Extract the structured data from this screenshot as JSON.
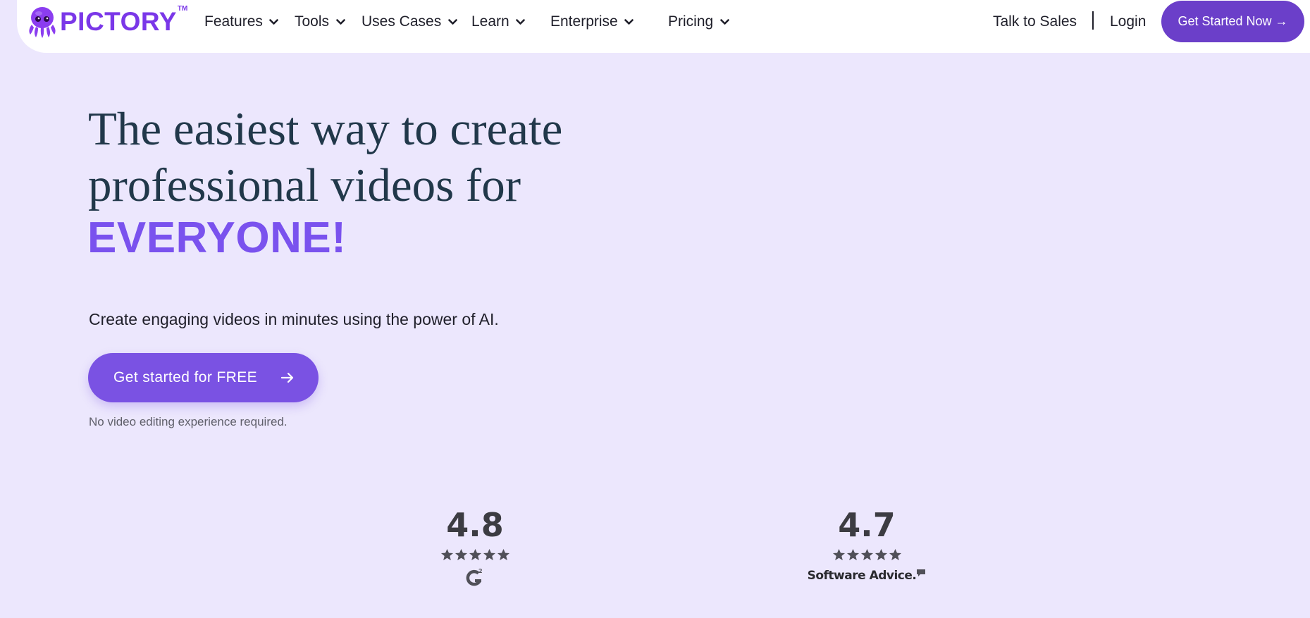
{
  "nav": {
    "brand": "PICTORY",
    "brand_tm": "TM",
    "items": [
      {
        "label": "Features"
      },
      {
        "label": "Tools"
      },
      {
        "label": "Uses Cases"
      },
      {
        "label": "Learn"
      },
      {
        "label": "Enterprise"
      },
      {
        "label": "Pricing"
      }
    ],
    "talk_to_sales": "Talk to Sales",
    "login": "Login",
    "cta": "Get Started Now →"
  },
  "hero": {
    "line1": "The easiest way to create",
    "line2": "professional videos for",
    "accent": "EVERYONE!",
    "subtext": "Create engaging videos in minutes using the power of AI.",
    "cta": "Get started for FREE",
    "note": "No video editing experience required."
  },
  "ratings": [
    {
      "score": "4.8",
      "stars": 5,
      "source": "G2"
    },
    {
      "score": "4.7",
      "stars": 5,
      "source": "Software Advice."
    }
  ],
  "colors": {
    "background": "#ece7fd",
    "brand_purple": "#7a37e8",
    "accent_purple": "#7a52ee",
    "cta_purple": "#7a52e3",
    "nav_cta": "#6b3fc9",
    "heading": "#21384a"
  },
  "icons": [
    "octopus-logo-icon",
    "chevron-down-icon",
    "arrow-right-icon",
    "star-icon",
    "g2-logo-icon",
    "speech-bubble-icon"
  ]
}
